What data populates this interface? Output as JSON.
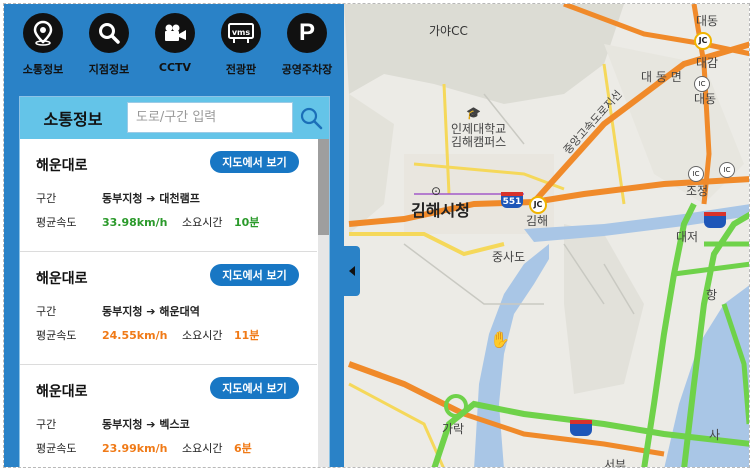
{
  "tabs": [
    {
      "label": "소통정보",
      "icon": "location-pin-icon"
    },
    {
      "label": "지점정보",
      "icon": "search-icon"
    },
    {
      "label": "CCTV",
      "icon": "video-camera-icon"
    },
    {
      "label": "전광판",
      "icon": "vms-sign-icon"
    },
    {
      "label": "공영주차장",
      "icon": "parking-icon"
    }
  ],
  "vms_text": "vms",
  "parking_text": "P",
  "panel": {
    "title": "소통정보",
    "search_placeholder": "도로/구간 입력"
  },
  "cards": [
    {
      "road": "해운대로",
      "button": "지도에서 보기",
      "section_label": "구간",
      "route": "동부지청 ➔ 대천램프",
      "speed_label": "평균속도",
      "speed": "33.98km/h",
      "time_label": "소요시간",
      "time": "10분",
      "status_color": "#2b9a2b"
    },
    {
      "road": "해운대로",
      "button": "지도에서 보기",
      "section_label": "구간",
      "route": "동부지청 ➔ 해운대역",
      "speed_label": "평균속도",
      "speed": "24.55km/h",
      "time_label": "소요시간",
      "time": "11분",
      "status_color": "#f07a17"
    },
    {
      "road": "해운대로",
      "button": "지도에서 보기",
      "section_label": "구간",
      "route": "동부지청 ➔ 벡스코",
      "speed_label": "평균속도",
      "speed": "23.99km/h",
      "time_label": "소요시간",
      "time": "6분",
      "status_color": "#f07a17"
    }
  ],
  "map": {
    "labels": {
      "gaya_cc": "가야CC",
      "daedong_top": "대동",
      "daegam": "대감",
      "daedong_small": "대동",
      "daedong_myeon": "대 동 면",
      "inje_univ": "인제대학교",
      "gimhae_campus": "김해캠퍼스",
      "gimhae_city": "김해시청",
      "gimhae": "김해",
      "jungsado": "중사도",
      "jojeong": "조정",
      "daejeo": "대저",
      "expressway": "중앙고속도로지선",
      "ic": "IC",
      "jc": "JC",
      "route_551": "551",
      "daehang": "항",
      "sa": "사",
      "gorak": "가락",
      "seobu": "서부"
    }
  }
}
